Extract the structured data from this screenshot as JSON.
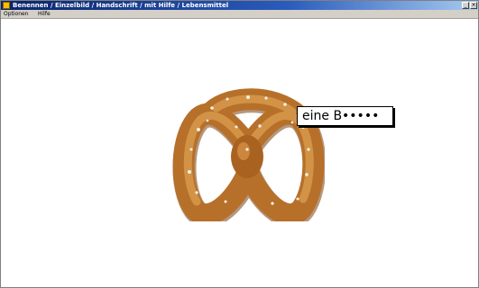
{
  "window": {
    "title": "Benennen / Einzelbild / Handschrift / mit Hilfe / Lebensmittel",
    "minimize": "_",
    "close": "×"
  },
  "menu": {
    "items": [
      "Optionen",
      "Hilfe"
    ]
  },
  "answer_label": {
    "text": "eine B•••••"
  },
  "picture": {
    "icon": "pretzel-image",
    "colors": {
      "crust": "#b6702a",
      "highlight": "#d89a4c",
      "shadow": "#7a4314",
      "salt": "#f4efe6"
    }
  }
}
